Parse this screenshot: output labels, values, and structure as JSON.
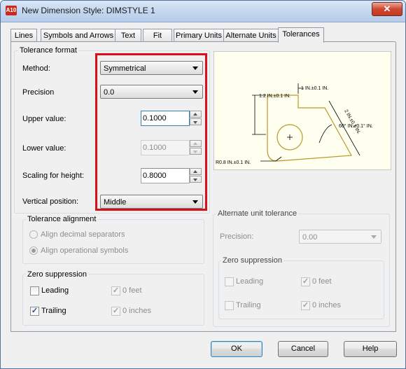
{
  "window": {
    "app_icon_text": "A10",
    "title": "New Dimension Style: DIMSTYLE 1",
    "close_glyph": "✕"
  },
  "tabs": [
    {
      "label": "Lines"
    },
    {
      "label": "Symbols and Arrows"
    },
    {
      "label": "Text"
    },
    {
      "label": "Fit"
    },
    {
      "label": "Primary Units"
    },
    {
      "label": "Alternate Units"
    },
    {
      "label": "Tolerances",
      "active": true
    }
  ],
  "tolerance_format": {
    "title": "Tolerance format",
    "method": {
      "label": "Method:",
      "value": "Symmetrical"
    },
    "precision": {
      "label": "Precision",
      "value": "0.0"
    },
    "upper_value": {
      "label": "Upper value:",
      "value": "0.1000"
    },
    "lower_value": {
      "label": "Lower value:",
      "value": "0.1000"
    },
    "scaling_height": {
      "label": "Scaling for height:",
      "value": "0.8000"
    },
    "vertical_position": {
      "label": "Vertical position:",
      "value": "Middle"
    }
  },
  "tolerance_alignment": {
    "title": "Tolerance alignment",
    "option1": "Align decimal separators",
    "option2": "Align operational symbols"
  },
  "zero_suppression": {
    "title": "Zero suppression",
    "leading": "Leading",
    "trailing": "Trailing",
    "zero_feet": "0 feet",
    "zero_inches": "0 inches"
  },
  "alternate_tolerance": {
    "title": "Alternate unit tolerance",
    "precision_label": "Precision:",
    "precision_value": "0.00",
    "zero_suppression": {
      "title": "Zero suppression",
      "leading": "Leading",
      "trailing": "Trailing",
      "zero_feet": "0 feet",
      "zero_inches": "0 inches"
    }
  },
  "preview": {
    "dim_top": "1 IN.±0.1 IN.",
    "dim_left": "1.2 IN.±0.1 IN.",
    "dim_angle_side": "2 IN.±0.1 IN.",
    "dim_angle": "60° IN.±0.1° IN.",
    "dim_radius": "R0.8 IN.±0.1 IN.",
    "line_color": "#b79a2a"
  },
  "buttons": {
    "ok": "OK",
    "cancel": "Cancel",
    "help": "Help"
  }
}
